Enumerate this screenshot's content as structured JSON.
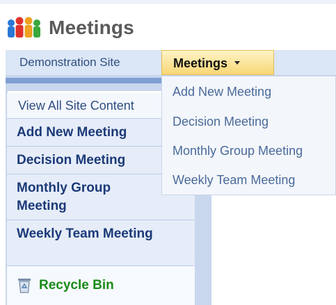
{
  "site": {
    "title": "Meetings"
  },
  "topnav": {
    "items": [
      {
        "label": "Demonstration Site"
      },
      {
        "label": "Meetings"
      }
    ]
  },
  "dropdown": {
    "items": [
      {
        "label": "Add New Meeting"
      },
      {
        "label": "Decision Meeting"
      },
      {
        "label": "Monthly Group Meeting"
      },
      {
        "label": "Weekly Team Meeting"
      }
    ]
  },
  "quicklaunch": {
    "view_all": "View All Site Content",
    "items": [
      {
        "label": "Add New Meeting"
      },
      {
        "label": "Decision Meeting"
      },
      {
        "label": "Monthly Group Meeting"
      },
      {
        "label": "Weekly Team Meeting"
      }
    ],
    "recycle_bin": "Recycle Bin"
  },
  "icons": {
    "title": "people-group-icon",
    "recycle": "recycle-bin-icon",
    "dropdown": "chevron-down-icon"
  }
}
